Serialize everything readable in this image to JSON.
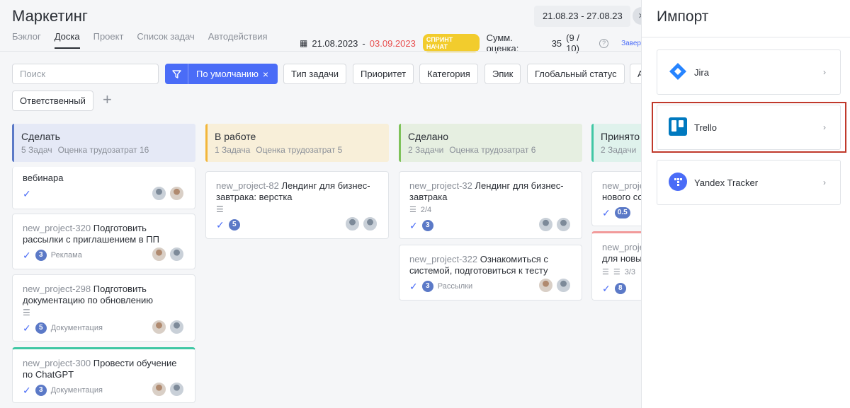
{
  "header": {
    "title": "Маркетинг",
    "date_range": "21.08.23 - 27.08.23",
    "tabs": [
      "Бэклог",
      "Доска",
      "Проект",
      "Список задач",
      "Автодействия"
    ],
    "active_tab": "Доска"
  },
  "sprint": {
    "start": "21.08.2023",
    "dash": "-",
    "end": "03.09.2023",
    "status": "СПРИНТ НАЧАТ",
    "estimate_label": "Сумм. оценка:",
    "estimate_value": "35",
    "estimate_detail": "(9 / 10)",
    "finish_link": "Завер"
  },
  "filters": {
    "search_placeholder": "Поиск",
    "default_label": "По умолчанию",
    "default_clear": "×",
    "chips": [
      "Тип задачи",
      "Приоритет",
      "Категория",
      "Эпик",
      "Глобальный статус",
      "А"
    ],
    "assignee": "Ответственный",
    "add": "+"
  },
  "columns": [
    {
      "title": "Сделать",
      "count": "5 Задач",
      "estimate": "Оценка трудозатрат 16",
      "color": "#5b79c7",
      "bg": "#e5e9f6"
    },
    {
      "title": "В работе",
      "count": "1 Задача",
      "estimate": "Оценка трудозатрат 5",
      "color": "#f2b63a",
      "bg": "#f8efd9"
    },
    {
      "title": "Сделано",
      "count": "2 Задачи",
      "estimate": "Оценка трудозатрат 6",
      "color": "#7ec25a",
      "bg": "#e6efe1"
    },
    {
      "title": "Принято",
      "count": "2 Задачи",
      "estimate": "",
      "color": "#3fc7a4",
      "bg": "#dff2ec"
    }
  ],
  "cards": {
    "todo": [
      {
        "key": "",
        "title": "вебинара",
        "badge": "",
        "tag": ""
      },
      {
        "key": "new_project-320",
        "title": "Подготовить рассылки с приглашением в ПП",
        "badge": "3",
        "tag": "Реклама"
      },
      {
        "key": "new_project-298",
        "title": "Подготовить документацию по обновлению",
        "badge": "5",
        "tag": "Документация"
      },
      {
        "key": "new_project-300",
        "title": "Провести обучение по ChatGPT",
        "badge": "3",
        "tag": "Документация"
      }
    ],
    "in_progress": [
      {
        "key": "new_project-82",
        "title": "Лендинг для бизнес-завтрака: верстка",
        "badge": "5",
        "tag": ""
      }
    ],
    "done": [
      {
        "key": "new_project-32",
        "title": "Лендинг для бизнес-завтрака",
        "subtasks": "2/4",
        "badge": "3",
        "tag": ""
      },
      {
        "key": "new_project-322",
        "title": "Ознакомиться с системой, подготовиться к тесту",
        "badge": "3",
        "tag": "Рассылки"
      }
    ],
    "accepted": [
      {
        "key": "new_proje",
        "title": "нового со",
        "badge": "0.5"
      },
      {
        "key": "new_proje",
        "title": "для новы",
        "subtasks": "3/3",
        "badge": "8"
      }
    ]
  },
  "import_panel": {
    "title": "Импорт",
    "close": "×",
    "items": [
      {
        "label": "Jira",
        "icon": "jira-icon",
        "color": "#2684ff"
      },
      {
        "label": "Trello",
        "icon": "trello-icon",
        "color": "#0079bf"
      },
      {
        "label": "Yandex Tracker",
        "icon": "yandex-tracker-icon",
        "color": "#4a6cf7"
      }
    ],
    "highlight_color": "#c0392b"
  }
}
